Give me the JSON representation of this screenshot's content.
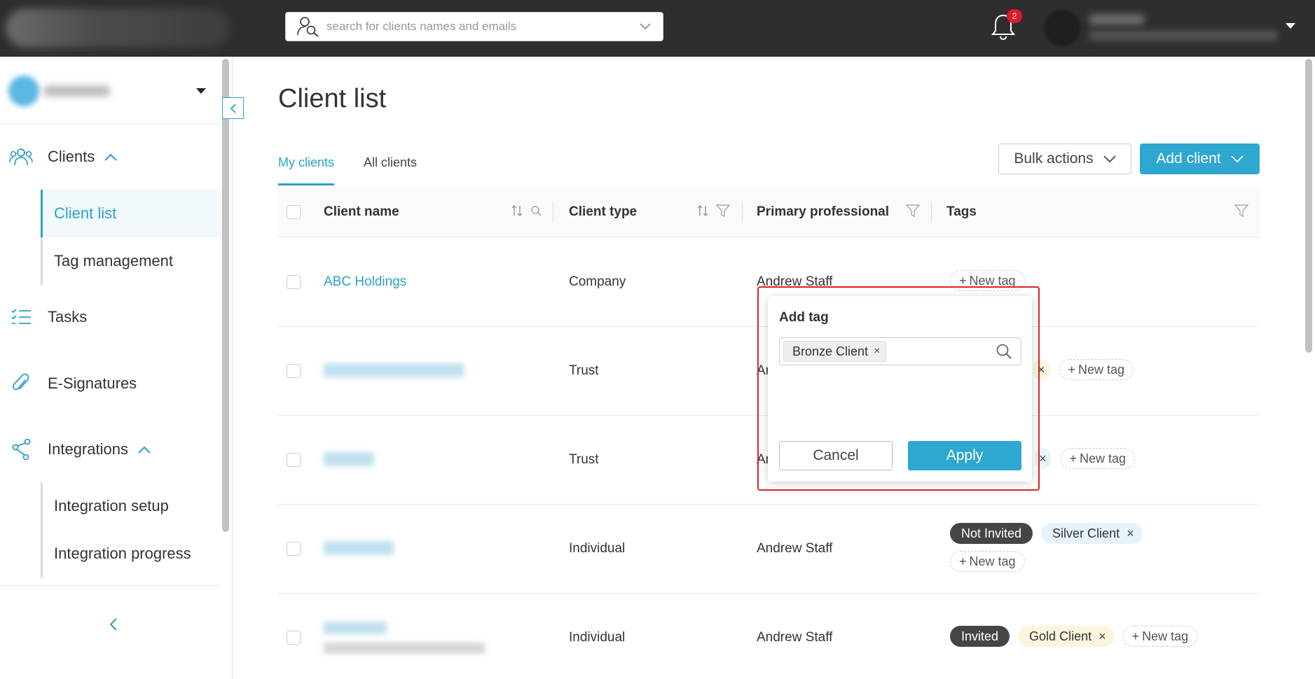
{
  "header": {
    "search_placeholder": "search for clients names and emails",
    "notification_count": "2"
  },
  "sidebar": {
    "nav": {
      "clients": "Clients",
      "client_list": "Client list",
      "tag_management": "Tag management",
      "tasks": "Tasks",
      "esignatures": "E-Signatures",
      "integrations": "Integrations",
      "integration_setup": "Integration setup",
      "integration_progress": "Integration progress"
    }
  },
  "main": {
    "title": "Client list",
    "tabs": [
      "My clients",
      "All clients"
    ],
    "bulk_actions": "Bulk actions",
    "add_client": "Add client",
    "columns": [
      "Client name",
      "Client type",
      "Primary professional",
      "Tags"
    ],
    "new_tag": "New tag",
    "rows": [
      {
        "name": "ABC Holdings",
        "type": "Company",
        "professional": "Andrew Staff"
      },
      {
        "name": "",
        "type": "Trust",
        "professional": "An"
      },
      {
        "name": "",
        "type": "Trust",
        "professional": "An"
      },
      {
        "name": "",
        "type": "Individual",
        "professional": "Andrew Staff",
        "status": "Not Invited",
        "tag": "Silver Client"
      },
      {
        "name": "",
        "type": "Individual",
        "professional": "Andrew Staff",
        "status": "Invited",
        "tag": "Gold Client"
      }
    ]
  },
  "popup": {
    "title": "Add tag",
    "chip": "Bronze Client",
    "cancel": "Cancel",
    "apply": "Apply"
  },
  "colors": {
    "accent": "#2ea7d1",
    "topbar": "#2e2e2e",
    "highlight": "#e02020"
  }
}
